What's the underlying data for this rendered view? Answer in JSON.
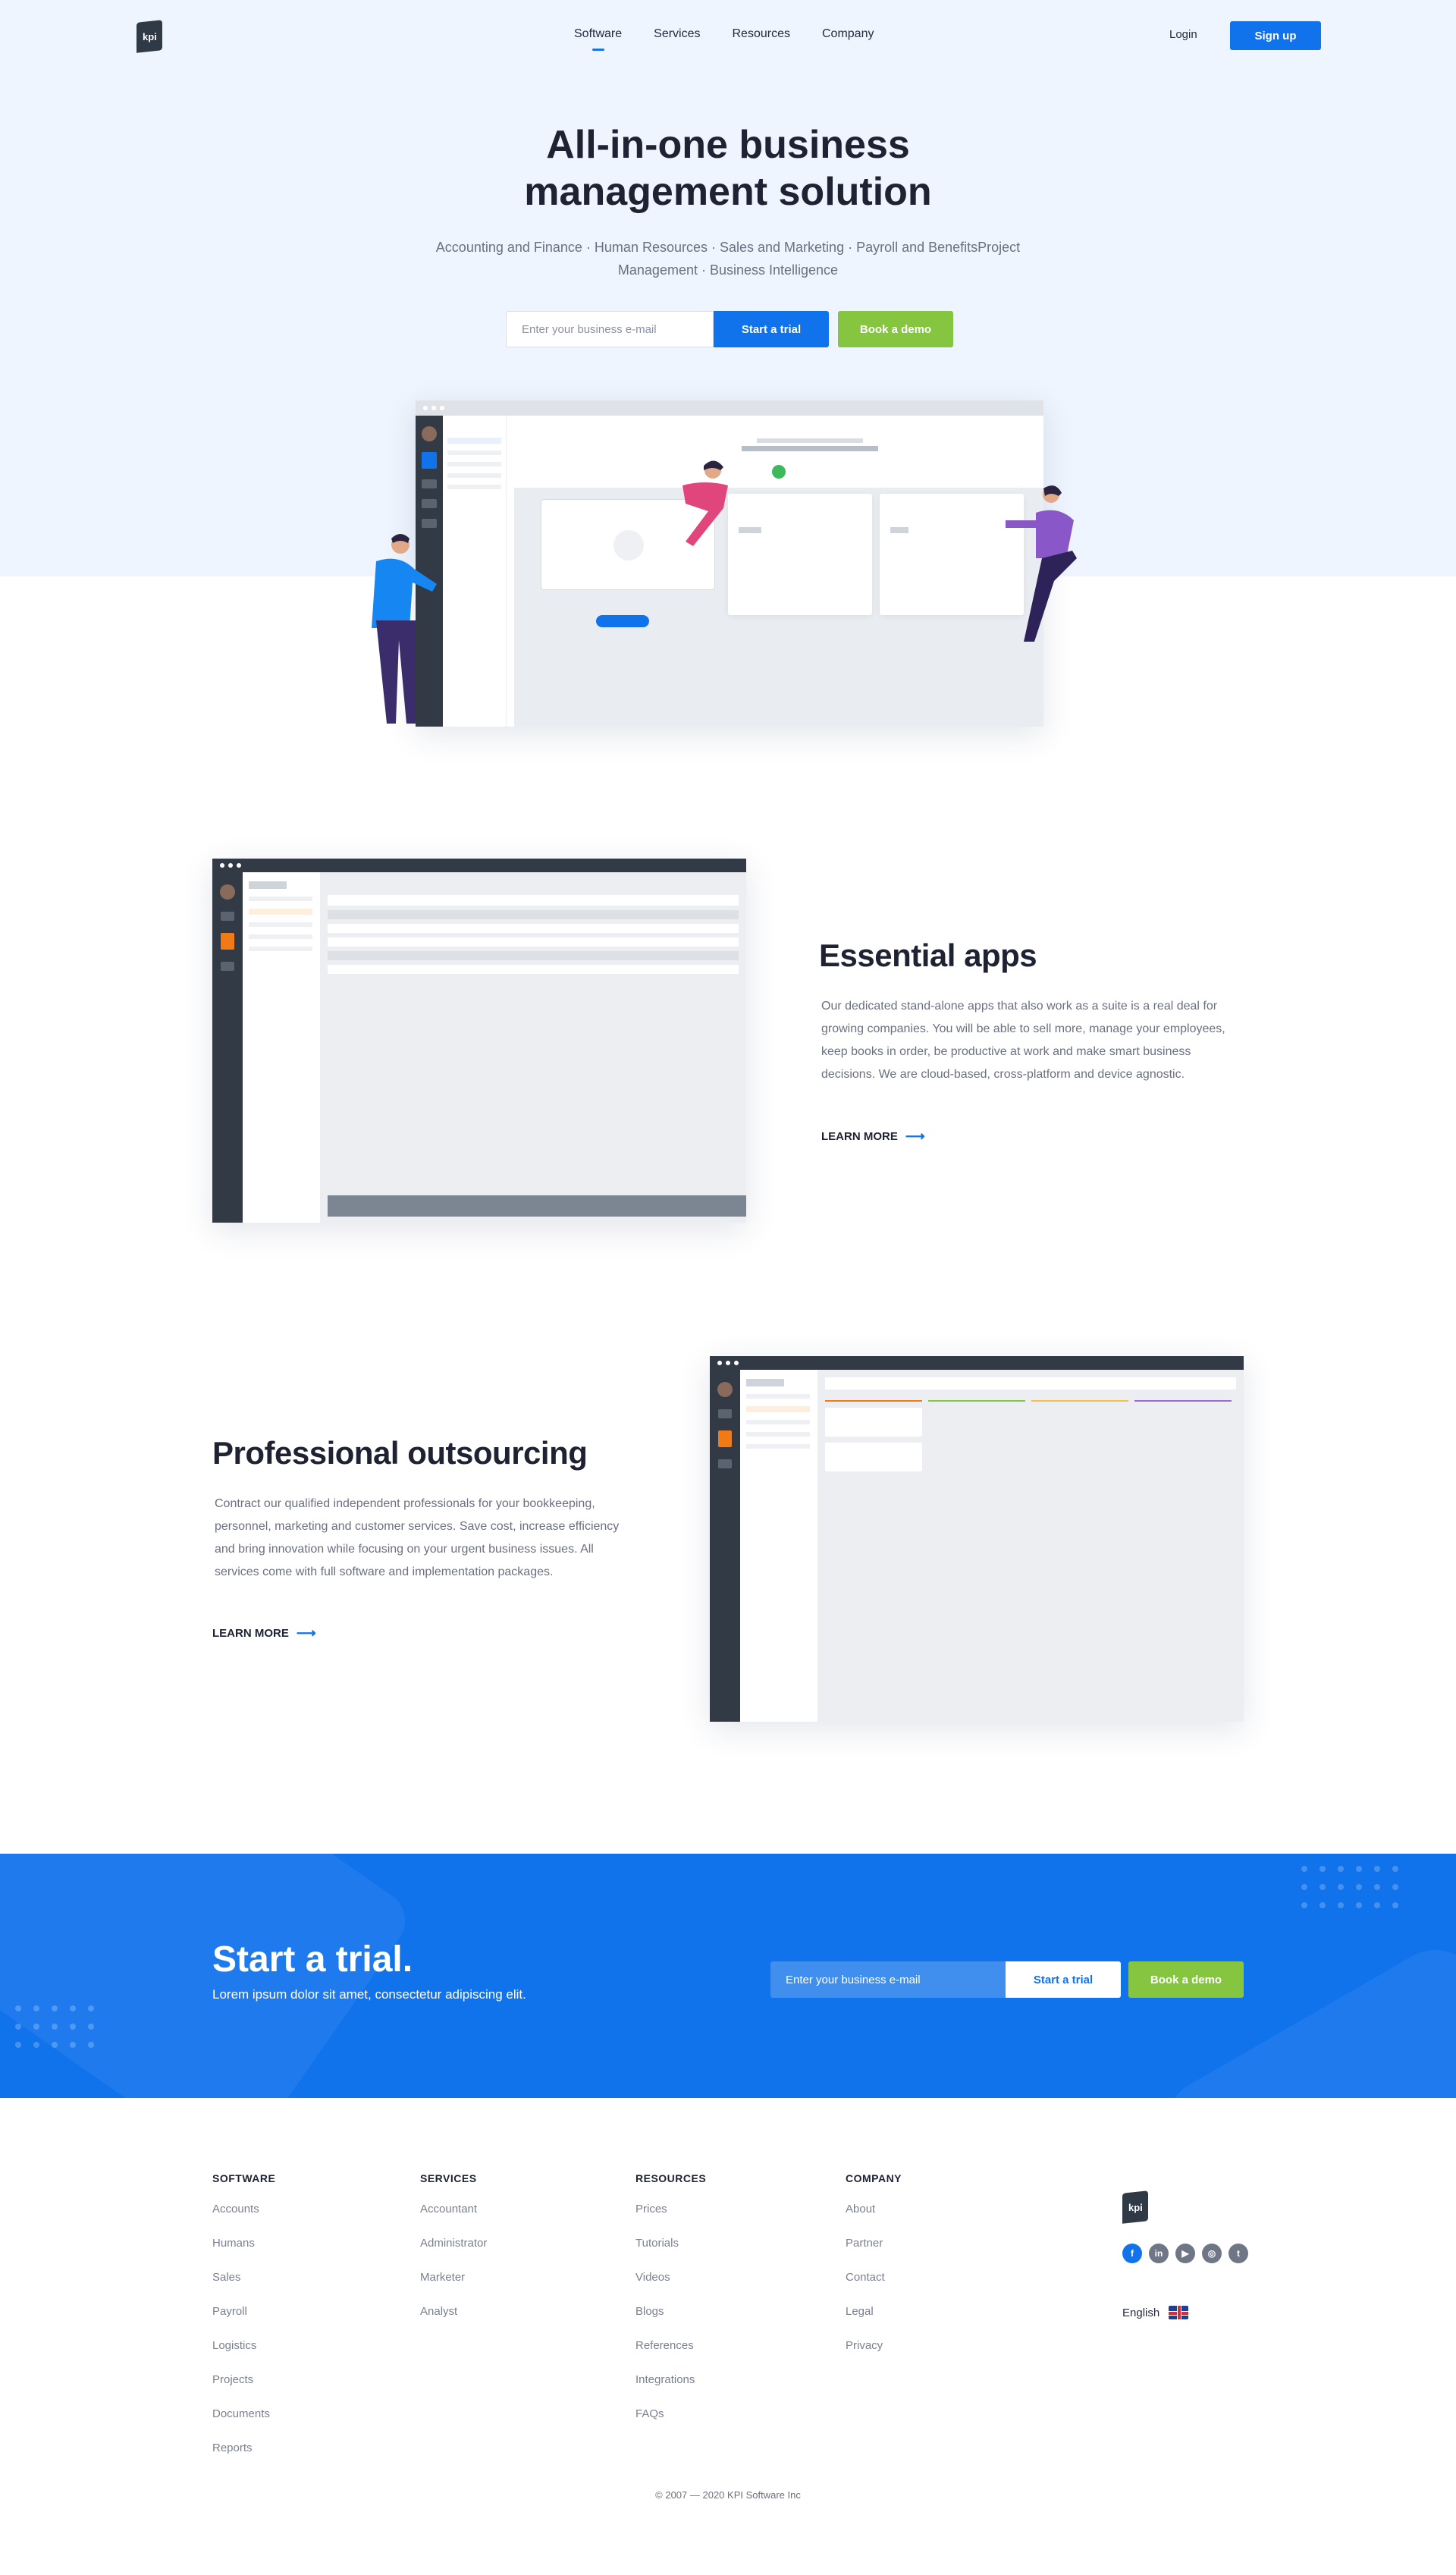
{
  "brand": {
    "logo_text": "kpi"
  },
  "nav": {
    "items": [
      "Software",
      "Services",
      "Resources",
      "Company"
    ],
    "login": "Login",
    "signup": "Sign up"
  },
  "hero": {
    "title": "All-in-one business management solution",
    "subtitle": "Accounting and Finance · Human Resources · Sales and Marketing · Payroll and BenefitsProject Management · Business Intelligence",
    "email_placeholder": "Enter your business e-mail",
    "trial_button": "Start a trial",
    "demo_button": "Book a demo"
  },
  "essential": {
    "title": "Essential apps",
    "text": "Our dedicated stand-alone apps that also work as a suite is a real deal for growing companies. You will be able to sell more, manage your employees, keep books in order, be productive at work and make smart business decisions. We are cloud-based, cross-platform and device agnostic.",
    "link": "LEARN MORE"
  },
  "outsourcing": {
    "title": "Professional outsourcing",
    "text": "Contract our qualified independent professionals for your bookkeeping, personnel, marketing and customer services. Save cost, increase efficiency and bring innovation while focusing on your urgent business issues. All services come with full software and implementation packages.",
    "link": "LEARN MORE"
  },
  "trial": {
    "title": "Start a trial.",
    "subtitle": "Lorem ipsum dolor sit amet, consectetur adipiscing elit.",
    "email_placeholder": "Enter your business e-mail",
    "trial_button": "Start a trial",
    "demo_button": "Book a demo"
  },
  "footer": {
    "columns": [
      {
        "heading": "SOFTWARE",
        "links": [
          "Accounts",
          "Humans",
          "Sales",
          "Payroll",
          "Logistics",
          "Projects",
          "Documents",
          "Reports"
        ]
      },
      {
        "heading": "SERVICES",
        "links": [
          "Accountant",
          "Administrator",
          "Marketer",
          "Analyst"
        ]
      },
      {
        "heading": "RESOURCES",
        "links": [
          "Prices",
          "Tutorials",
          "Videos",
          "Blogs",
          "References",
          "Integrations",
          "FAQs"
        ]
      },
      {
        "heading": "COMPANY",
        "links": [
          "About",
          "Partner",
          "Contact",
          "Legal",
          "Privacy"
        ]
      }
    ],
    "social": [
      "facebook-icon",
      "linkedin-icon",
      "youtube-icon",
      "instagram-icon",
      "twitter-icon"
    ],
    "language": "English",
    "copyright": "© 2007 — 2020 KPI Software Inc"
  },
  "colors": {
    "primary": "#1173ec",
    "green": "#86c53f",
    "dark": "#1f2233",
    "hero_bg": "#eef5fe"
  }
}
